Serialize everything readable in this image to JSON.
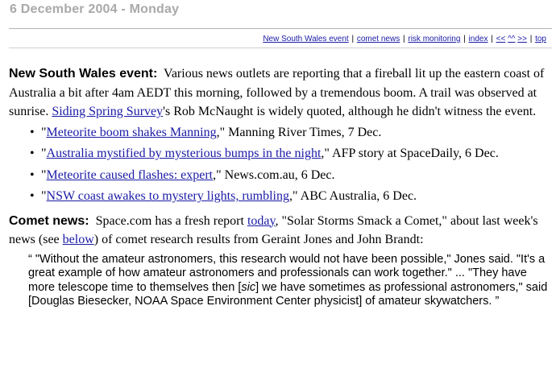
{
  "date_header": "6 December 2004 - Monday",
  "nav": {
    "items": [
      "New South Wales event",
      "comet news",
      "risk monitoring",
      "index",
      "<<",
      "^^",
      ">>",
      "top"
    ]
  },
  "nsw": {
    "title": "New South Wales event:",
    "text_1": "Various news outlets are reporting that a fireball lit up the eastern coast of Australia a bit after 4am AEDT this morning, followed by a tremendous boom. A trail was observed at sunrise.",
    "link_siding": "Siding Spring Survey",
    "text_2": "'s Rob McNaught is widely quoted, although he didn't witness the event.",
    "bullets": [
      {
        "open": "\"",
        "link": "Meteorite boom shakes Manning",
        "rest": ",\" Manning River Times, 7 Dec."
      },
      {
        "open": "\"",
        "link": "Australia mystified by mysterious bumps in the night",
        "rest": ",\" AFP story at SpaceDaily, 6 Dec."
      },
      {
        "open": "\"",
        "link": "Meteorite caused flashes: expert",
        "rest": ",\" News.com.au, 6 Dec."
      },
      {
        "open": "\"",
        "link": "NSW coast awakes to mystery lights, rumbling",
        "rest": ",\" ABC Australia, 6 Dec."
      }
    ]
  },
  "comet": {
    "title": "Comet news:",
    "text_1": "Space.com has a fresh report",
    "link_today": "today",
    "text_2": ", \"Solar Storms Smack a Comet,\" about last week's news (see",
    "link_below": "below",
    "text_3": ") of comet research results from Geraint Jones and John Brandt:",
    "quote_1": "“ \"Without the amateur astronomers, this research would not have been possible,\" Jones said. \"It's a great example of how amateur astronomers and professionals can work together.\" ... \"They have more telescope time to themselves then [",
    "quote_sic": "sic",
    "quote_2": "] we have sometimes as professional astronomers,\" said [Douglas Biesecker, NOAA Space Environment Center physicist] of amateur skywatchers. ”"
  }
}
